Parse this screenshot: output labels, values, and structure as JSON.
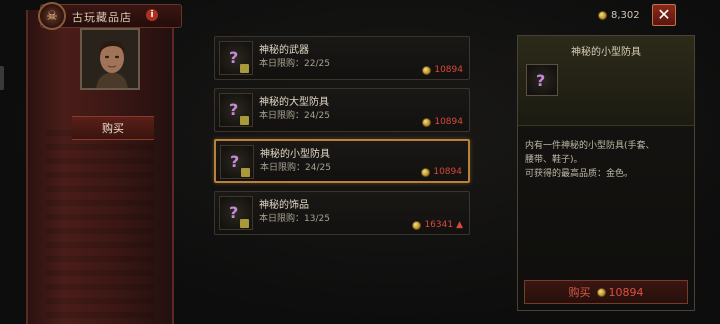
{
  "shop": {
    "title": "古玩藏品店",
    "info_icon": "i",
    "emblem_icon": "shop-emblem-icon",
    "buy_tab_label": "购买"
  },
  "currency": {
    "gold_amount": "8,302",
    "coin_color": "#d4a830"
  },
  "close_icon": "✕",
  "items": [
    {
      "name": "神秘的武器",
      "limit": "本日限购：22/25",
      "price": "10894",
      "price_up": false
    },
    {
      "name": "神秘的大型防具",
      "limit": "本日限购：24/25",
      "price": "10894",
      "price_up": false
    },
    {
      "name": "神秘的小型防具",
      "limit": "本日限购：24/25",
      "price": "10894",
      "price_up": false,
      "selected": true
    },
    {
      "name": "神秘的饰品",
      "limit": "本日限购：13/25",
      "price": "16341",
      "price_up": true
    }
  ],
  "item_icon_glyph": "?",
  "detail": {
    "title": "神秘的小型防具",
    "desc_line1": "内有一件神秘的小型防具(手套、",
    "desc_line2": "腰带、鞋子)。",
    "desc_line3": "可获得的最高品质：金色。",
    "buy_label": "购买",
    "buy_price": "10894"
  },
  "colors": {
    "accent_gold": "#b8823a",
    "price_red": "#d84a3a",
    "banner_red": "#4a1d19"
  }
}
